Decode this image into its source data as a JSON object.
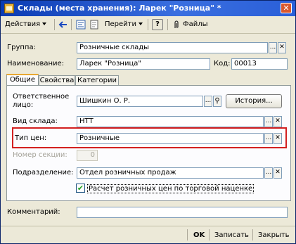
{
  "window": {
    "title": "Склады (места хранения): Ларек \"Розница\" *",
    "close_glyph": "✕"
  },
  "toolbar": {
    "actions_label": "Действия",
    "goto_label": "Перейти",
    "help_label": "?",
    "files_label": "Файлы"
  },
  "header": {
    "group_label": "Группа:",
    "group_value": "Розничные склады",
    "name_label": "Наименование:",
    "name_value": "Ларек \"Розница\"",
    "code_label": "Код:",
    "code_value": "00013"
  },
  "tabs": [
    {
      "label": "Общие"
    },
    {
      "label": "Свойства"
    },
    {
      "label": "Категории"
    }
  ],
  "general": {
    "responsible_label": "Ответственное лицо:",
    "responsible_value": "Шишкин О. Р.",
    "history_button": "История...",
    "warehouse_type_label": "Вид склада:",
    "warehouse_type_value": "НТТ",
    "price_type_label": "Тип цен:",
    "price_type_value": "Розничные",
    "section_label": "Номер секции:",
    "section_value": "0",
    "division_label": "Подразделение:",
    "division_value": "Отдел розничных продаж",
    "markup_checkbox_label": "Расчет розничных цен по торговой наценке",
    "markup_checked": true
  },
  "comment": {
    "label": "Комментарий:",
    "value": ""
  },
  "footer": {
    "ok_label": "OK",
    "save_label": "Записать",
    "close_label": "Закрыть"
  },
  "glyphs": {
    "select": "...",
    "clear": "✕",
    "search": "⚲",
    "check": "✔"
  },
  "colors": {
    "title_bar": "#0a3bb3",
    "highlight": "#d32020",
    "field_border": "#7f9db9",
    "tab_accent": "#e8a832"
  }
}
